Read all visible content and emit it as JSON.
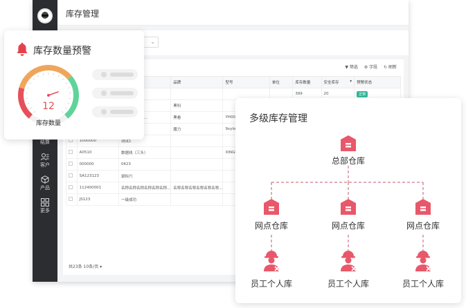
{
  "app": {
    "title": "库存管理",
    "sidebar": [
      {
        "label": "结算",
        "icon": "settle-icon"
      },
      {
        "label": "客户",
        "icon": "customer-icon"
      },
      {
        "label": "产品",
        "icon": "product-icon"
      },
      {
        "label": "更多",
        "icon": "more-icon"
      }
    ],
    "toolbar": {
      "filter": "筛选",
      "columns": "字段",
      "refresh": "刷新"
    },
    "table": {
      "headers": [
        "",
        "",
        "品牌",
        "型号",
        "单位",
        "库存数量",
        "安全库存",
        "预警状态"
      ],
      "rows": [
        [
          "",
          "",
          "",
          "",
          "",
          "399",
          "20",
          "正常"
        ],
        [
          "",
          "",
          "黑科",
          "",
          "",
          "",
          "",
          ""
        ],
        [
          "",
          "示屏显示屏型...",
          "黑看",
          "YH0001",
          "",
          "",
          "",
          ""
        ],
        [
          "",
          "",
          "魔力",
          "9xylop",
          "",
          "",
          "",
          ""
        ],
        [
          "1000000",
          "测试1",
          "",
          "",
          "",
          "",
          "",
          ""
        ],
        [
          "A0510",
          "数据线（三头）",
          "",
          "XINGHAO",
          "",
          "",
          "",
          ""
        ],
        [
          "000000",
          "0423",
          "",
          "",
          "",
          "",
          "",
          ""
        ],
        [
          "SA123123",
          "鼠标穴",
          "",
          "",
          "",
          "",
          "",
          ""
        ],
        [
          "112400001",
          "名称名称名称名称名称名称...",
          "名称名称名称名称名称名称...",
          "",
          "",
          "",
          "",
          ""
        ],
        [
          "JS123",
          "一级成功",
          "",
          "",
          "",
          "",
          "",
          ""
        ]
      ]
    },
    "pager": "共23条    10条/页 ▾"
  },
  "warning": {
    "title": "库存数量预警",
    "gauge_value": "12",
    "gauge_label": "库存数量",
    "colors": {
      "red": "#e5505a",
      "orange": "#f0a65a",
      "green": "#5fd49a"
    }
  },
  "tree": {
    "title": "多级库存管理",
    "root": "总部仓库",
    "branches": [
      "网点仓库",
      "网点仓库",
      "网点仓库"
    ],
    "leaves": [
      "员工个人库",
      "员工个人库",
      "员工个人库"
    ],
    "accent": "#e8586a"
  }
}
